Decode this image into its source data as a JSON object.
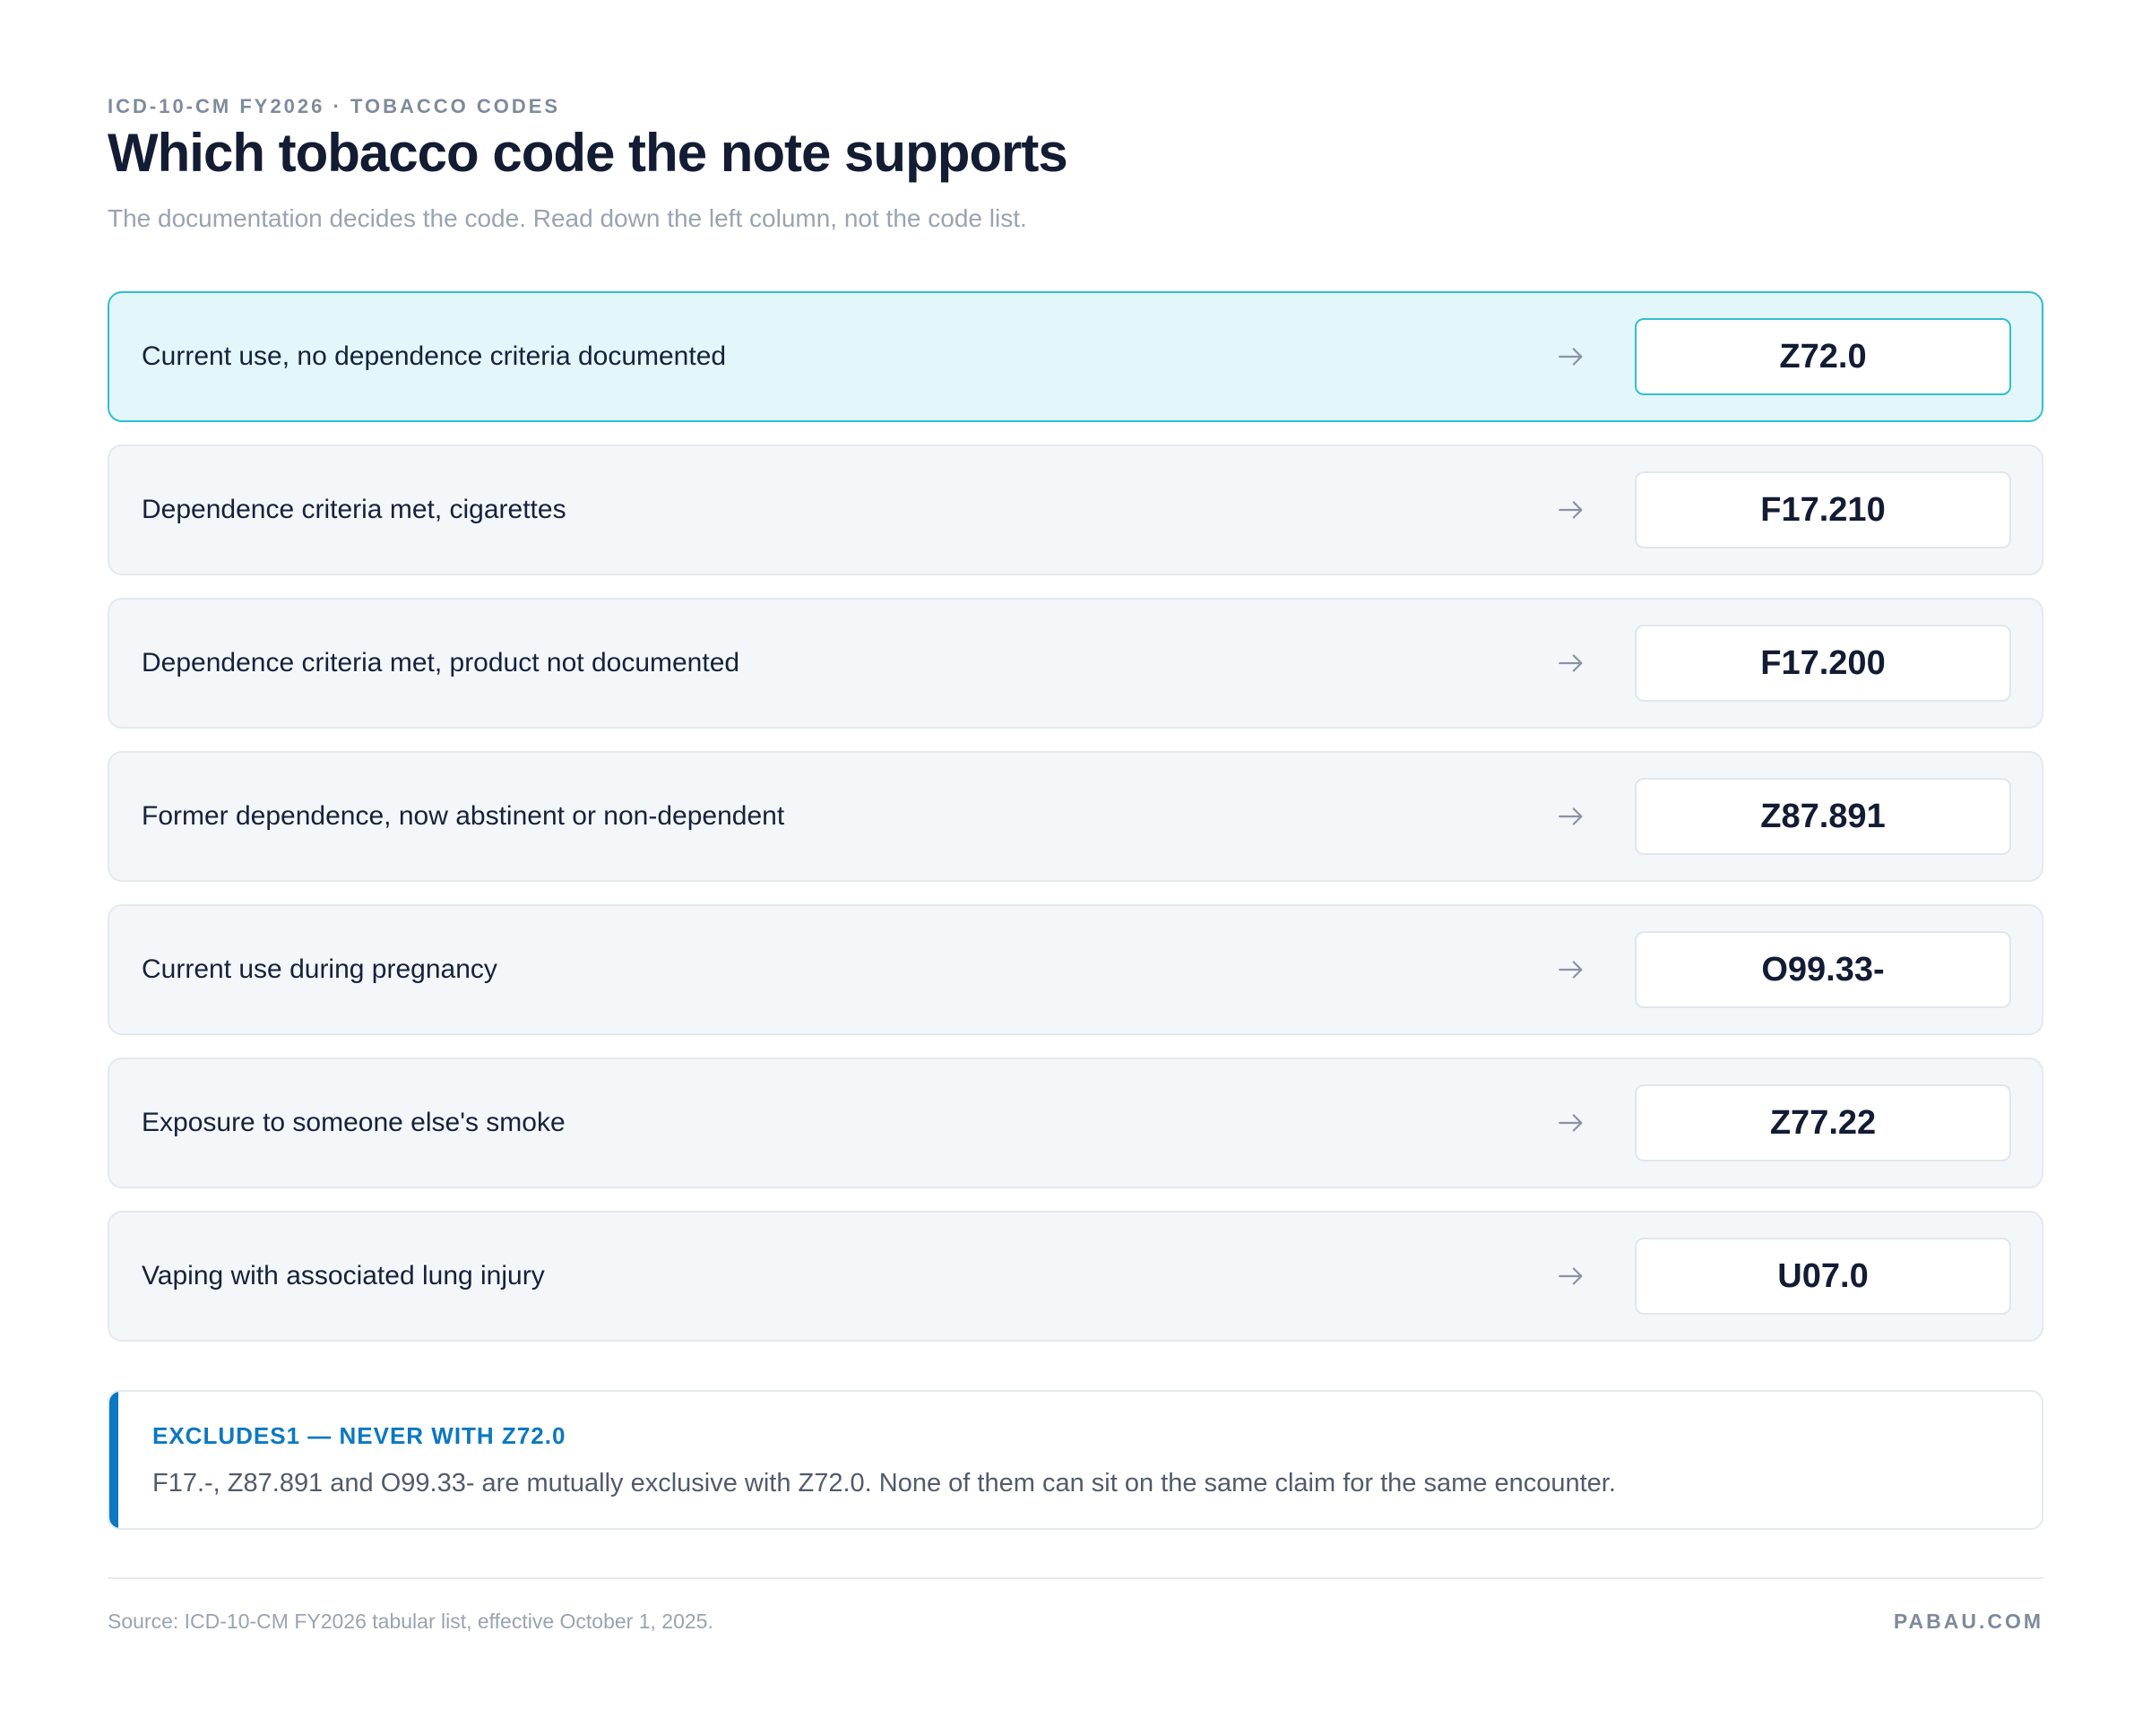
{
  "header": {
    "eyebrow": "ICD-10-CM FY2026 · TOBACCO CODES",
    "title": "Which tobacco code the note supports",
    "subtitle": "The documentation decides the code. Read down the left column, not the code list."
  },
  "rows": [
    {
      "label": "Current use, no dependence criteria documented",
      "code": "Z72.0",
      "highlighted": true,
      "icon": "arrow-right-icon"
    },
    {
      "label": "Dependence criteria met, cigarettes",
      "code": "F17.210",
      "highlighted": false,
      "icon": "arrow-right-icon"
    },
    {
      "label": "Dependence criteria met, product not documented",
      "code": "F17.200",
      "highlighted": false,
      "icon": "arrow-right-icon"
    },
    {
      "label": "Former dependence, now abstinent or non-dependent",
      "code": "Z87.891",
      "highlighted": false,
      "icon": "arrow-right-icon"
    },
    {
      "label": "Current use during pregnancy",
      "code": "O99.33-",
      "highlighted": false,
      "icon": "arrow-right-icon"
    },
    {
      "label": "Exposure to someone else's smoke",
      "code": "Z77.22",
      "highlighted": false,
      "icon": "arrow-right-icon"
    },
    {
      "label": "Vaping with associated lung injury",
      "code": "U07.0",
      "highlighted": false,
      "icon": "arrow-right-icon"
    }
  ],
  "note": {
    "heading": "EXCLUDES1 — NEVER WITH Z72.0",
    "body": "F17.-, Z87.891 and O99.33- are mutually exclusive with Z72.0. None of them can sit on the same claim for the same encounter."
  },
  "footer": {
    "source": "Source: ICD-10-CM FY2026 tabular list, effective October 1, 2025.",
    "brand": "PABAU.COM"
  },
  "colors": {
    "highlight_background": "#e3f6fa",
    "highlight_border": "#2fbfd2",
    "row_background": "#f4f7fa",
    "accent_blue": "#0b78c2",
    "title_text": "#131c33",
    "muted_text": "#9aa3b2"
  }
}
